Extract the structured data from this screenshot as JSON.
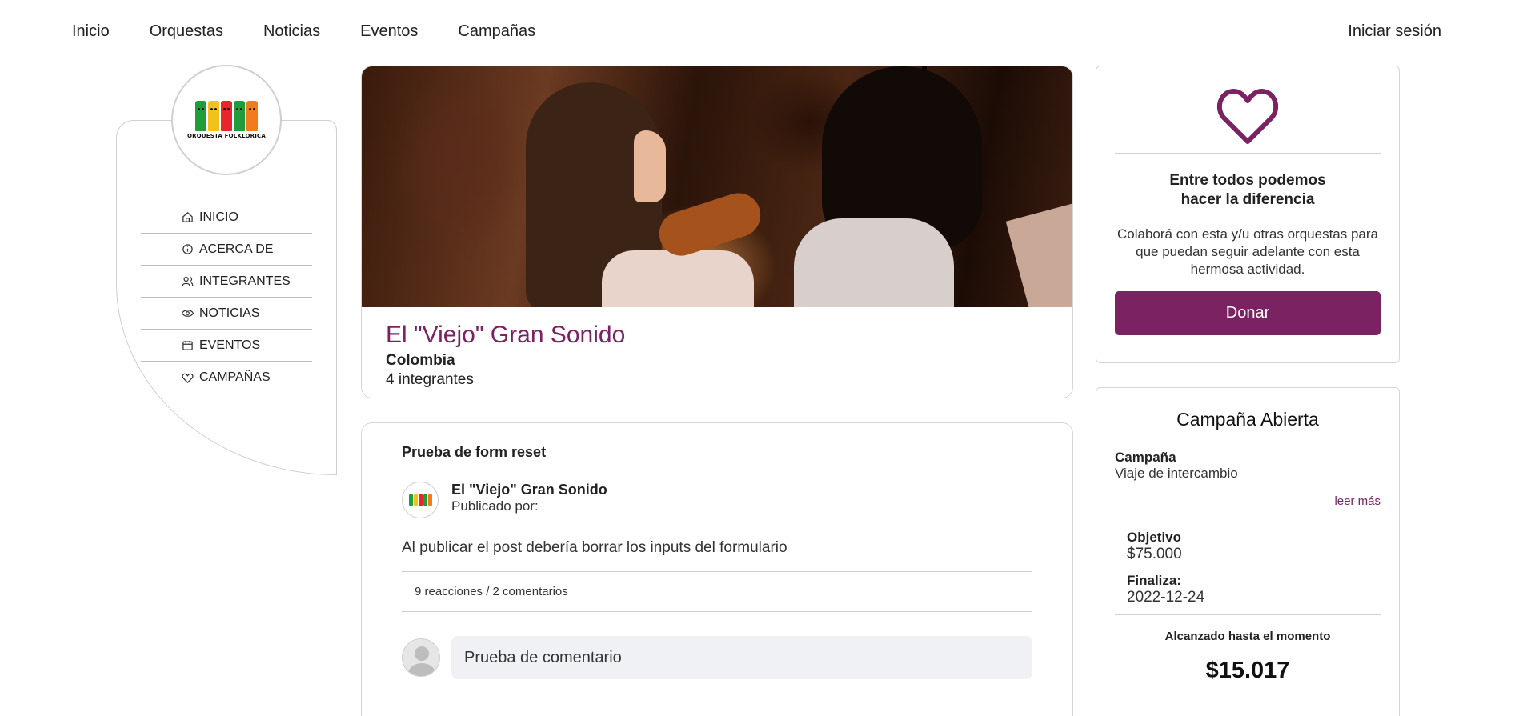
{
  "nav": {
    "links": [
      "Inicio",
      "Orquestas",
      "Noticias",
      "Eventos",
      "Campañas"
    ],
    "login": "Iniciar sesión"
  },
  "sidebar": {
    "logo_text": "ORQUESTA FOLKLORICA",
    "items": [
      {
        "label": "INICIO",
        "icon": "home-icon"
      },
      {
        "label": "ACERCA DE",
        "icon": "info-icon"
      },
      {
        "label": "INTEGRANTES",
        "icon": "users-icon"
      },
      {
        "label": "NOTICIAS",
        "icon": "eye-icon"
      },
      {
        "label": "EVENTOS",
        "icon": "calendar-icon"
      },
      {
        "label": "CAMPAÑAS",
        "icon": "heart-icon"
      }
    ]
  },
  "orchestra": {
    "name": "El \"Viejo\" Gran Sonido",
    "country": "Colombia",
    "members": "4 integrantes"
  },
  "post": {
    "title": "Prueba de form reset",
    "author": "El \"Viejo\" Gran Sonido",
    "published_by": "Publicado por:",
    "body": "Al publicar el post debería borrar los inputs del formulario",
    "stats": "9 reacciones / 2 comentarios",
    "comment": "Prueba de comentario"
  },
  "donate": {
    "headline": "Entre todos podemos hacer la diferencia",
    "description": "Colaborá con esta y/u otras orquestas para que puedan seguir adelante con esta hermosa actividad.",
    "button": "Donar"
  },
  "campaign": {
    "title": "Campaña Abierta",
    "label": "Campaña",
    "name": "Viaje de intercambio",
    "more": "leer más",
    "goal_label": "Objetivo",
    "goal": "$75.000",
    "end_label": "Finaliza:",
    "end": "2022-12-24",
    "reached_label": "Alcanzado hasta el momento",
    "reached": "$15.017"
  },
  "colors": {
    "accent": "#7b2263",
    "logo": [
      "#1f9d3a",
      "#f2c21b",
      "#e8262a",
      "#1f9d3a",
      "#f27b1b"
    ]
  }
}
